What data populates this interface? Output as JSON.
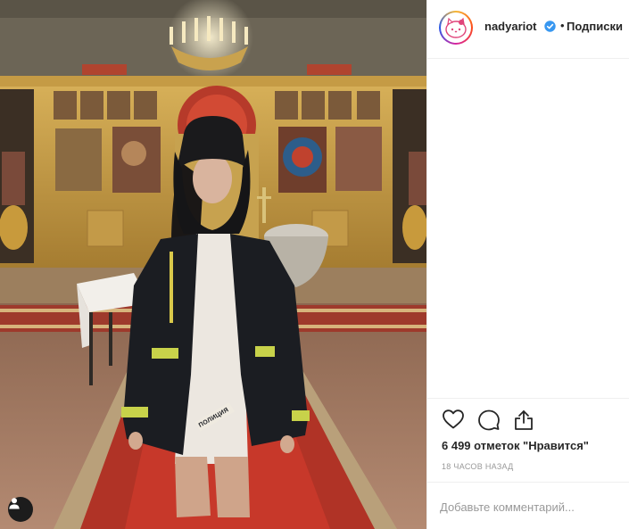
{
  "post": {
    "username": "nadyariot",
    "separator": "•",
    "follow_label": "Подписки",
    "likes_text": "6 499 отметок \"Нравится\"",
    "timestamp": "18 часов назад",
    "comment_placeholder": "Добавьте комментарий...",
    "jacket_text": "ПОЛИЦИЯ"
  },
  "icons": {
    "avatar": "hello-kitty-icon",
    "verified": "verified-badge-icon",
    "like": "heart-icon",
    "comment": "comment-bubble-icon",
    "share": "share-icon",
    "tag": "user-icon"
  },
  "colors": {
    "verified_blue": "#3897f0",
    "text": "#262626",
    "secondary_text": "#999999",
    "divider": "#efefef"
  }
}
